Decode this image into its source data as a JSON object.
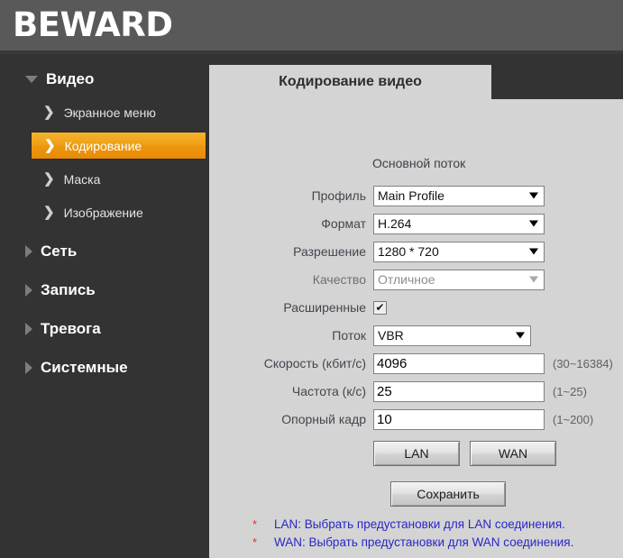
{
  "brand": {
    "logo": "BEWARD"
  },
  "sidebar": {
    "items": [
      {
        "label": "Видео",
        "level": "top",
        "icon": "triangle-down-icon",
        "expanded": true
      },
      {
        "label": "Экранное меню",
        "level": "sub",
        "icon": "chevron-right-icon",
        "active": false
      },
      {
        "label": "Кодирование",
        "level": "sub",
        "icon": "chevron-right-icon",
        "active": true
      },
      {
        "label": "Маска",
        "level": "sub",
        "icon": "chevron-right-icon",
        "active": false
      },
      {
        "label": "Изображение",
        "level": "sub",
        "icon": "chevron-right-icon",
        "active": false
      },
      {
        "label": "Сеть",
        "level": "top",
        "icon": "triangle-right-icon",
        "expanded": false
      },
      {
        "label": "Запись",
        "level": "top",
        "icon": "triangle-right-icon",
        "expanded": false
      },
      {
        "label": "Тревога",
        "level": "top",
        "icon": "triangle-right-icon",
        "expanded": false
      },
      {
        "label": "Системные",
        "level": "top",
        "icon": "triangle-right-icon",
        "expanded": false
      }
    ]
  },
  "page": {
    "title": "Кодирование видео",
    "section_title": "Основной поток"
  },
  "form": {
    "profile": {
      "label": "Профиль",
      "value": "Main Profile"
    },
    "format": {
      "label": "Формат",
      "value": "H.264"
    },
    "resolution": {
      "label": "Разрешение",
      "value": "1280 * 720"
    },
    "quality": {
      "label": "Качество",
      "value": "Отличное"
    },
    "advanced": {
      "label": "Расширенные",
      "checked": "✔"
    },
    "stream": {
      "label": "Поток",
      "value": "VBR"
    },
    "bitrate": {
      "label": "Скорость (кбит/с)",
      "value": "4096",
      "hint": "(30~16384)"
    },
    "framerate": {
      "label": "Частота (к/с)",
      "value": "25",
      "hint": "(1~25)"
    },
    "keyframe": {
      "label": "Опорный кадр",
      "value": "10",
      "hint": "(1~200)"
    }
  },
  "buttons": {
    "lan": "LAN",
    "wan": "WAN",
    "save": "Сохранить"
  },
  "notes": [
    {
      "star": "*",
      "text": "LAN: Выбрать предустановки для LAN соединения."
    },
    {
      "star": "*",
      "text": "WAN: Выбрать предустановки для WAN соединения."
    }
  ],
  "colors": {
    "sidebar_bg": "#333333",
    "header_bg": "#595959",
    "accent_orange": "#ec960c",
    "content_bg": "#d4d4d4",
    "note_blue": "#2727c8",
    "star_red": "#e03030"
  }
}
